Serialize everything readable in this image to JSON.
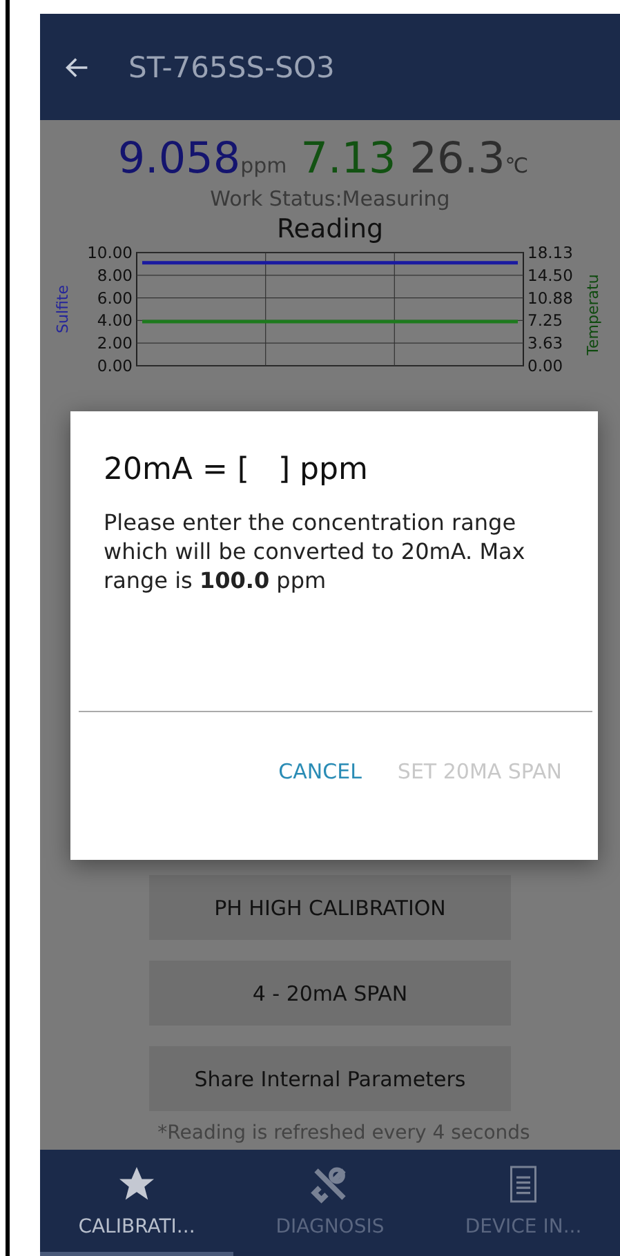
{
  "app_bar": {
    "title": "ST-765SS-SO3"
  },
  "readings": [
    {
      "kind": "sulfite",
      "value": "9.058",
      "unit": "ppm"
    },
    {
      "kind": "ph",
      "value": "7.13"
    },
    {
      "kind": "temperature",
      "value": "26.3",
      "unit": "℃"
    }
  ],
  "work_status": "Work Status:Measuring",
  "chart": {
    "right_axis": {
      "label": "Temperatu",
      "ticks": [
        "18.13",
        "14.50",
        "10.88",
        "7.25",
        "3.63",
        "0.00"
      ]
    },
    "chart_data": {
      "type": "line",
      "title": "Reading",
      "ylabel": "Sulfite",
      "grid": true,
      "ylim": [
        0,
        10
      ],
      "yticks": [
        {
          "value": 0,
          "label": "0.00"
        },
        {
          "value": 2,
          "label": "2.00"
        },
        {
          "value": 4,
          "label": "4.00"
        },
        {
          "value": 6,
          "label": "6.00"
        },
        {
          "value": 8,
          "label": "8.00"
        },
        {
          "value": 10,
          "label": "10.00"
        }
      ],
      "series": [
        {
          "color": "#1a1aa0",
          "values": [
            9.1,
            9.1,
            9.1,
            9.1
          ]
        },
        {
          "color": "#1e7a1e",
          "values": [
            3.9,
            3.9,
            3.9,
            3.9
          ]
        }
      ]
    }
  },
  "buttons": [
    {
      "label": "PH HIGH CALIBRATION"
    },
    {
      "label": "4 - 20mA SPAN"
    },
    {
      "label": "Share Internal Parameters"
    }
  ],
  "footnote": "*Reading is refreshed every 4 seconds",
  "tabs": [
    {
      "label": "CALIBRATI...",
      "selected": true
    },
    {
      "label": "DIAGNOSIS",
      "selected": false
    },
    {
      "label": "DEVICE IN...",
      "selected": false
    }
  ],
  "dialog": {
    "title": "20mA = [   ] ppm",
    "message": "Please enter the concentration range which will be converted to 20mA. Max range is **100.0** ppm",
    "actions": [
      {
        "label": "CANCEL",
        "disabled": false
      },
      {
        "label": "SET 20MA SPAN",
        "disabled": true
      }
    ]
  }
}
